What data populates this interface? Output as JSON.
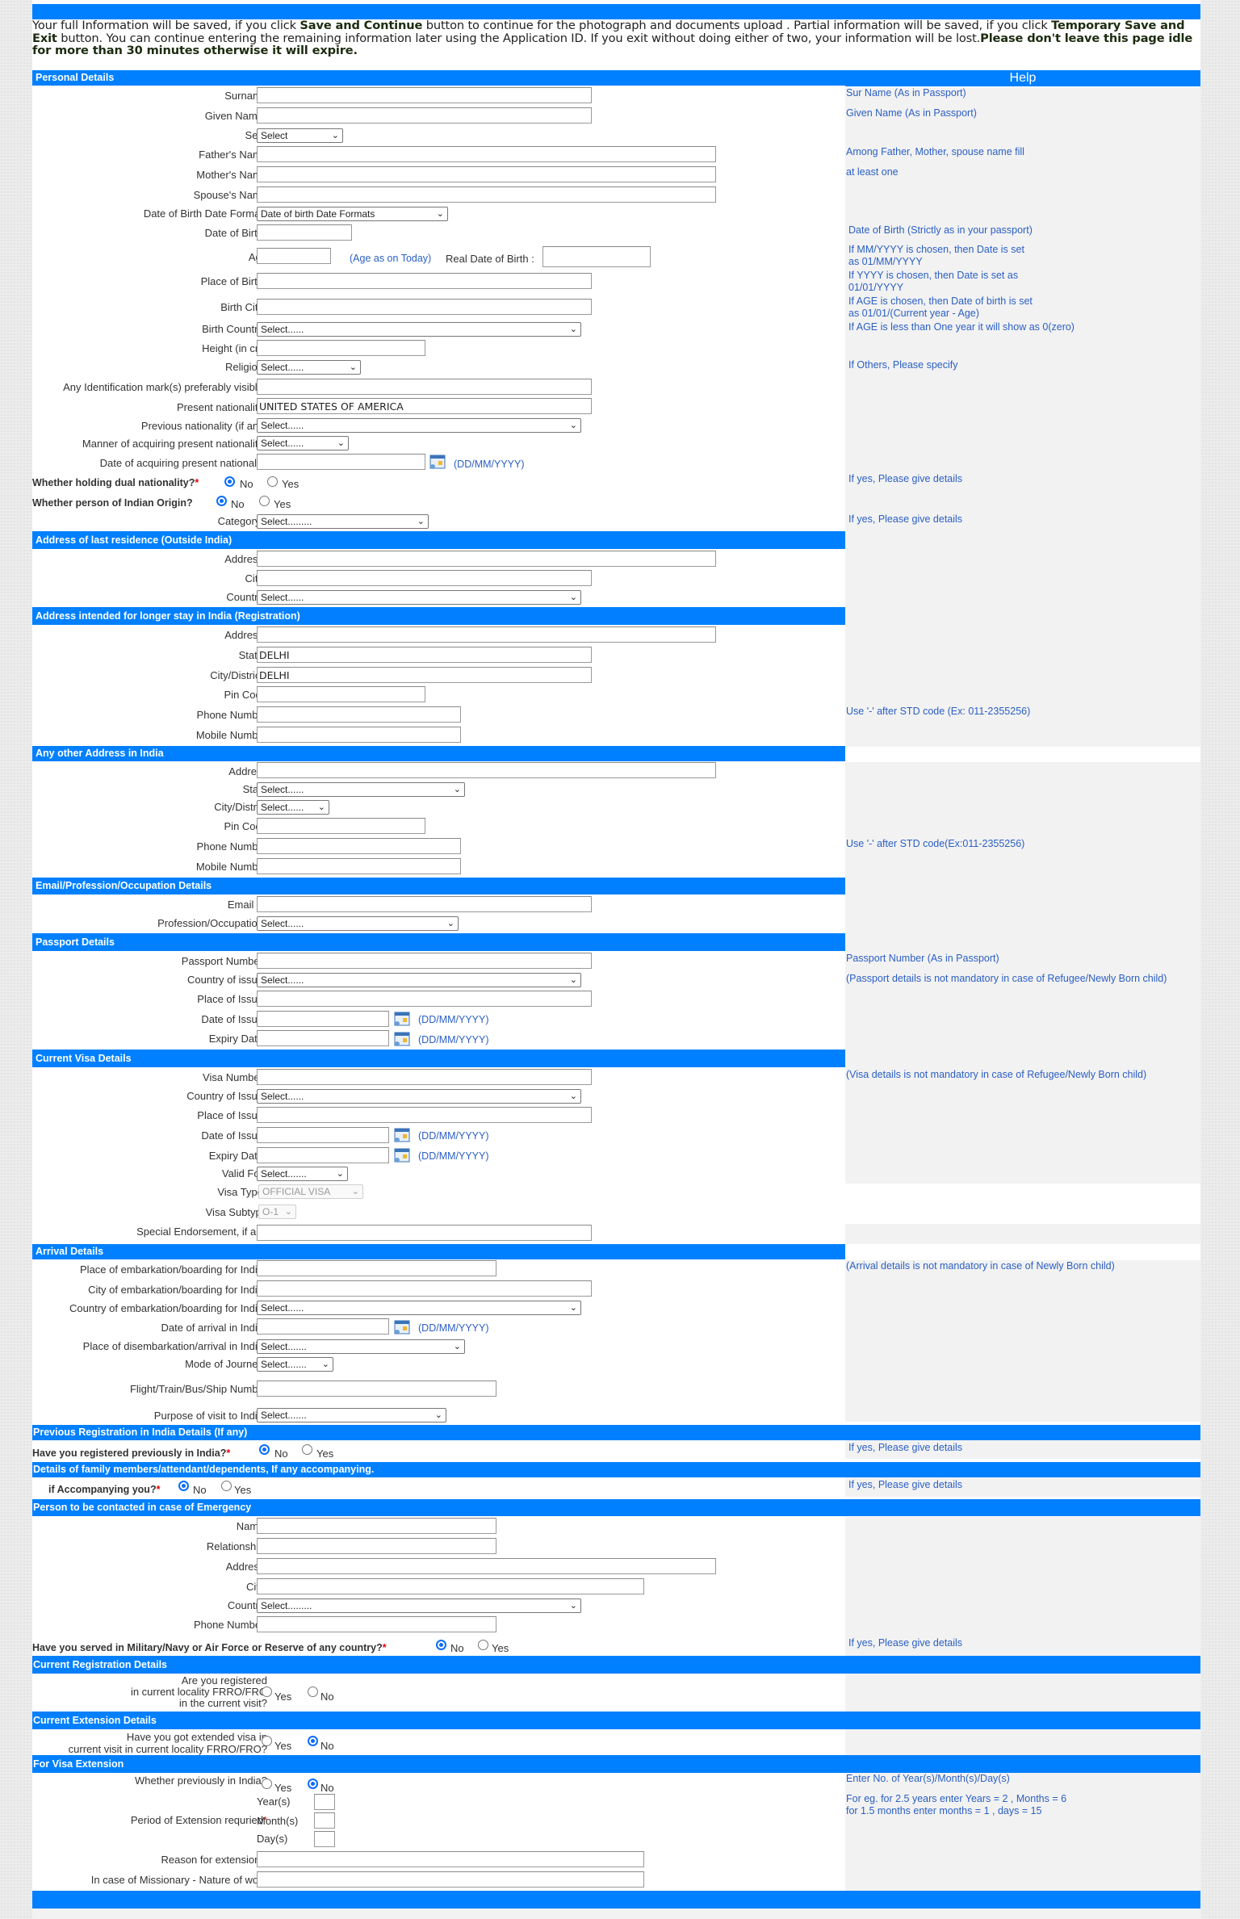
{
  "intro": {
    "p1": "Your full Information will be saved, if you click ",
    "b1": "Save and Continue",
    "p2": " button to continue for the photograph and documents upload . Partial information will be saved, if you click ",
    "b2": "Temporary Save and Exit",
    "p3": " button. You can continue entering the remaining information later using the Application ID. If you exit without doing either of two, your information will be lost.",
    "b3": "Please don't leave this page idle for more than 30 minutes otherwise it will expire."
  },
  "help_title": "Help",
  "sections": {
    "personal": "Personal Details",
    "last_residence": "Address of last residence (Outside India)",
    "longer_stay": "Address intended for longer stay in India (Registration)",
    "other_address": "Any other Address in India",
    "email": "Email/Profession/Occupation Details",
    "passport": "Passport Details",
    "visa": "Current Visa Details",
    "arrival": "Arrival Details",
    "prev_reg": "Previous Registration in India Details (If any)",
    "family": "Details of family members/attendant/dependents, If any accompanying.",
    "emergency": "Person to be contacted in case of Emergency",
    "current_reg": "Current Registration Details",
    "current_ext": "Current Extension Details",
    "visa_ext": "For Visa Extension"
  },
  "common": {
    "required_mark": "*",
    "date_format": "(DD/MM/YYYY)",
    "select_default": "Select......",
    "select_long": "Select.........",
    "select_7": "Select.......",
    "yes": "Yes",
    "no": "No",
    "chevron": "⌄"
  },
  "personal": {
    "surname": {
      "label": "Surname",
      "value": ""
    },
    "given_name": {
      "label": "Given Name",
      "value": ""
    },
    "sex": {
      "label": "Sex",
      "value": "Select"
    },
    "father": {
      "label": "Father's Name",
      "value": ""
    },
    "mother": {
      "label": "Mother's Name",
      "value": ""
    },
    "spouse": {
      "label": "Spouse's Name",
      "value": ""
    },
    "dob_format": {
      "label": "Date of Birth Date Format",
      "value": "Date of birth Date Formats"
    },
    "dob": {
      "label": "Date of Birth",
      "value": ""
    },
    "age": {
      "label": "Age",
      "value": "",
      "note": "(Age as on Today)",
      "real_dob_label": "Real Date of Birth :",
      "real_dob_value": ""
    },
    "place_of_birth": {
      "label": "Place of Birth",
      "value": ""
    },
    "birth_city": {
      "label": "Birth City",
      "value": ""
    },
    "birth_country": {
      "label": "Birth Country",
      "value": "Select......"
    },
    "height": {
      "label": "Height (in cm)",
      "value": ""
    },
    "religion": {
      "label": "Religion",
      "value": "Select......"
    },
    "id_mark": {
      "label": "Any Identification mark(s) preferably visible",
      "value": ""
    },
    "present_nationality": {
      "label": "Present nationality",
      "value": "UNITED STATES OF AMERICA"
    },
    "previous_nationality": {
      "label": "Previous nationality (if any)",
      "value": "Select......"
    },
    "manner_nationality": {
      "label": "Manner of acquiring present nationality",
      "value": "Select......"
    },
    "date_nationality": {
      "label": "Date of acquiring present nationality",
      "value": ""
    },
    "dual_nationality": {
      "label": "Whether holding dual nationality?",
      "selected": "No"
    },
    "indian_origin": {
      "label": "Whether person of Indian Origin?",
      "selected": "No"
    },
    "category": {
      "label": "Category:",
      "value": "Select........."
    }
  },
  "help": {
    "surname": "Sur Name (As in Passport)",
    "given_name": "Given Name (As in Passport)",
    "parents1": "Among Father, Mother, spouse name fill",
    "parents2": "at least one",
    "dob": "Date of Birth (Strictly as in your passport)",
    "mmyyyy1": "If MM/YYYY is chosen, then Date is set",
    "mmyyyy2": "as 01/MM/YYYY",
    "yyyy1": "If YYYY is chosen, then Date is set as",
    "yyyy2": "01/01/YYYY",
    "age1": "If AGE is chosen, then Date of birth is set",
    "age2": "as 01/01/(Current year - Age)",
    "age3": "If AGE is less than One year it will show as 0(zero)",
    "religion": "If Others, Please specify",
    "dual": "If yes, Please give details",
    "category": "If yes, Please give details",
    "phone_reg": "Use '-' after STD code (Ex: 011-2355256)",
    "phone_other": "Use '-' after STD code(Ex:011-2355256)",
    "passport_number": "Passport Number (As in Passport)",
    "passport_note": "(Passport details is not mandatory in case of Refugee/Newly Born child)",
    "visa_note": "(Visa details is not mandatory in case of Refugee/Newly Born child)",
    "arrival_note": "(Arrival details is not mandatory in case of Newly Born child)",
    "prev_reg": "If yes, Please give details",
    "family": "If yes, Please give details",
    "military": "If yes, Please give details",
    "ext1": "Enter No. of Year(s)/Month(s)/Day(s)",
    "ext2": "For eg. for 2.5 years enter Years = 2 , Months = 6",
    "ext3": "for 1.5 months enter months = 1 , days = 15"
  },
  "last_residence": {
    "address": {
      "label": "Address",
      "value": ""
    },
    "city": {
      "label": "City",
      "value": ""
    },
    "country": {
      "label": "Country",
      "value": "Select......"
    }
  },
  "longer_stay": {
    "address": {
      "label": "Address",
      "value": ""
    },
    "state": {
      "label": "State",
      "value": "DELHI"
    },
    "city": {
      "label": "City/District",
      "value": "DELHI"
    },
    "pin": {
      "label": "Pin Code",
      "value": ""
    },
    "phone": {
      "label": "Phone Number",
      "value": ""
    },
    "mobile": {
      "label": "Mobile Number",
      "value": ""
    }
  },
  "other_address": {
    "address": {
      "label": "Address",
      "value": ""
    },
    "state": {
      "label": "State",
      "value": "Select......"
    },
    "city": {
      "label": "City/District",
      "value": "Select......"
    },
    "pin": {
      "label": "Pin Code",
      "value": ""
    },
    "phone": {
      "label": "Phone Number",
      "value": ""
    },
    "mobile": {
      "label": "Mobile Number",
      "value": ""
    }
  },
  "email": {
    "email": {
      "label": "Email ID",
      "value": ""
    },
    "profession": {
      "label": "Profession/Occupation",
      "value": "Select......"
    }
  },
  "passport": {
    "number": {
      "label": "Passport Number",
      "value": ""
    },
    "country": {
      "label": "Country of issue",
      "value": "Select......"
    },
    "place": {
      "label": "Place of Issue",
      "value": ""
    },
    "date_issue": {
      "label": "Date of Issue",
      "value": ""
    },
    "expiry": {
      "label": "Expiry Date",
      "value": ""
    }
  },
  "visa": {
    "number": {
      "label": "Visa Number",
      "value": ""
    },
    "country": {
      "label": "Country of Issue",
      "value": "Select......"
    },
    "place": {
      "label": "Place of Issue",
      "value": ""
    },
    "date_issue": {
      "label": "Date of Issue",
      "value": ""
    },
    "expiry": {
      "label": "Expiry Date",
      "value": ""
    },
    "valid_for": {
      "label": "Valid For",
      "value": "Select......."
    },
    "type": {
      "label": "Visa Type",
      "value": "OFFICIAL VISA"
    },
    "subtype": {
      "label": "Visa Subtype",
      "value": "O-1"
    },
    "endorsement": {
      "label": "Special Endorsement, if any",
      "value": ""
    }
  },
  "arrival": {
    "place": {
      "label": "Place of embarkation/boarding for India",
      "value": ""
    },
    "city": {
      "label": "City of embarkation/boarding for India",
      "value": ""
    },
    "country": {
      "label": "Country of embarkation/boarding for India",
      "value": "Select......"
    },
    "date": {
      "label": "Date of arrival in India",
      "value": ""
    },
    "disembark": {
      "label": "Place of disembarkation/arrival in India",
      "value": "Select......."
    },
    "mode": {
      "label": "Mode of Journey",
      "value": "Select......."
    },
    "flight": {
      "label": "Flight/Train/Bus/Ship Number",
      "value": ""
    },
    "purpose": {
      "label": "Purpose of visit to India",
      "value": "Select......."
    }
  },
  "prev_reg": {
    "label": "Have you registered previously in India?",
    "selected": "No"
  },
  "family": {
    "label": "if Accompanying you?",
    "selected": "No"
  },
  "emergency": {
    "name": {
      "label": "Name:",
      "value": ""
    },
    "relationship": {
      "label": "Relationship:",
      "value": ""
    },
    "address": {
      "label": "Address:",
      "value": ""
    },
    "city": {
      "label": "City:",
      "value": ""
    },
    "country": {
      "label": "Country:",
      "value": "Select........."
    },
    "phone": {
      "label": "Phone Number:",
      "value": ""
    },
    "military": {
      "label": "Have you served in Military/Navy or Air Force or Reserve of any country?",
      "selected": "No"
    }
  },
  "current_reg": {
    "label1": "Are you registered",
    "label2": "in current locality FRRO/FRO",
    "label3": "in the current visit?",
    "selected": ""
  },
  "current_ext": {
    "label1": "Have you got extended visa in",
    "label2": "current visit in current locality FRRO/FRO?",
    "selected": "No"
  },
  "visa_ext": {
    "previously": {
      "label": "Whether previously in India?",
      "selected": "No"
    },
    "period_label": "Period of Extension requried",
    "years": {
      "label": "Year(s)",
      "value": ""
    },
    "months": {
      "label": "Month(s)",
      "value": ""
    },
    "days": {
      "label": "Day(s)",
      "value": ""
    },
    "reason": {
      "label": "Reason for extension ",
      "value": ""
    },
    "missionary": {
      "label": "In case of Missionary - Nature of work",
      "value": ""
    }
  }
}
